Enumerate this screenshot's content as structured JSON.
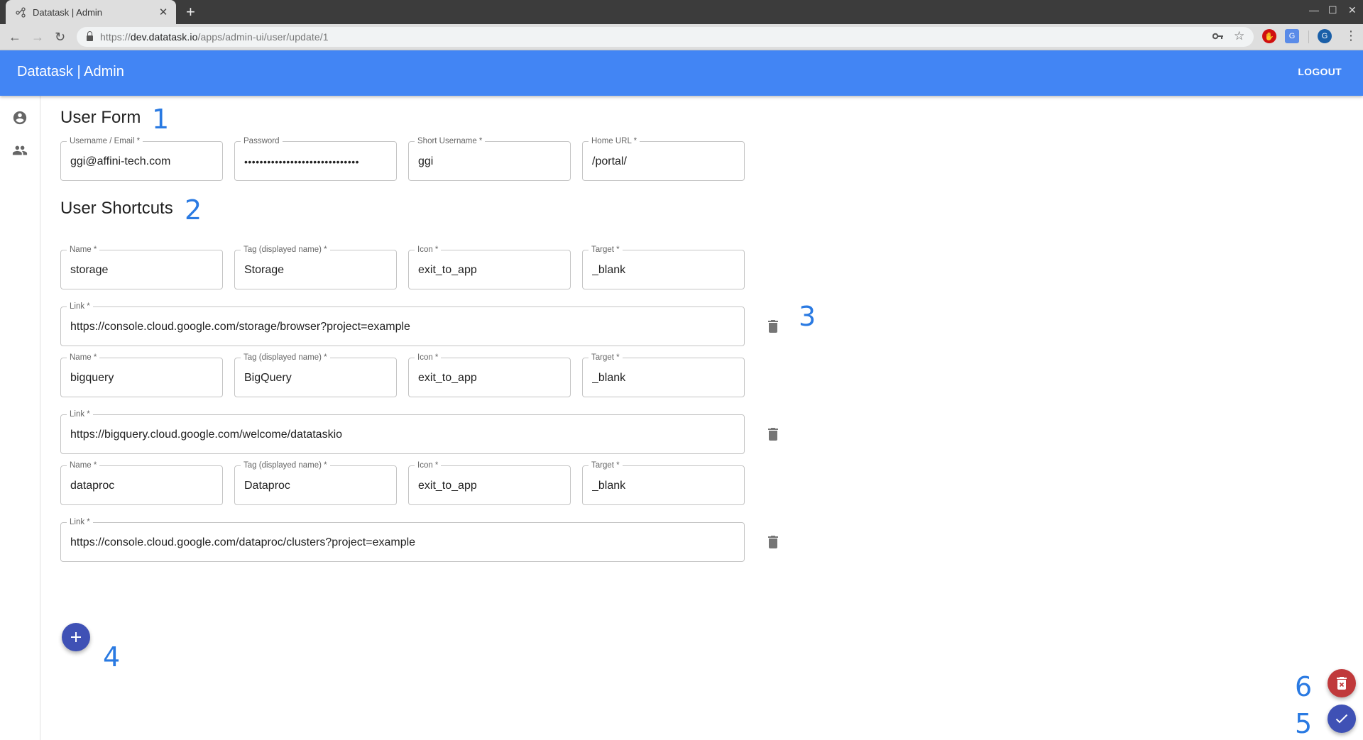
{
  "browser": {
    "tab_title": "Datatask | Admin",
    "url_prefix": "https://",
    "url_host": "dev.datatask.io",
    "url_path": "/apps/admin-ui/user/update/1",
    "profile_initial": "G"
  },
  "app": {
    "brand": "Datatask | Admin",
    "logout_label": "LOGOUT",
    "colors": {
      "primary": "#4285f4",
      "fab_blue": "#3f51b5",
      "fab_red": "#c0393b",
      "annotation": "#2a7ae2"
    }
  },
  "sidebar": {
    "items": [
      {
        "icon": "account-circle-icon"
      },
      {
        "icon": "people-icon"
      }
    ]
  },
  "user_form": {
    "title": "User Form",
    "annotation": "1",
    "fields": [
      {
        "label": "Username / Email *",
        "value": "ggi@affini-tech.com"
      },
      {
        "label": "Password",
        "value": "••••••••••••••••••••••••••••••"
      },
      {
        "label": "Short Username *",
        "value": "ggi"
      },
      {
        "label": "Home URL *",
        "value": "/portal/"
      }
    ]
  },
  "shortcuts": {
    "title": "User Shortcuts",
    "annotation": "2",
    "delete_annotation": "3",
    "add_annotation": "4",
    "labels": {
      "name": "Name *",
      "tag": "Tag (displayed name) *",
      "icon": "Icon *",
      "target": "Target *",
      "link": "Link *"
    },
    "items": [
      {
        "name": "storage",
        "tag": "Storage",
        "icon": "exit_to_app",
        "target": "_blank",
        "link": "https://console.cloud.google.com/storage/browser?project=example"
      },
      {
        "name": "bigquery",
        "tag": "BigQuery",
        "icon": "exit_to_app",
        "target": "_blank",
        "link": "https://bigquery.cloud.google.com/welcome/datataskio"
      },
      {
        "name": "dataproc",
        "tag": "Dataproc",
        "icon": "exit_to_app",
        "target": "_blank",
        "link": "https://console.cloud.google.com/dataproc/clusters?project=example"
      }
    ]
  },
  "actions": {
    "delete_annotation": "6",
    "save_annotation": "5"
  }
}
